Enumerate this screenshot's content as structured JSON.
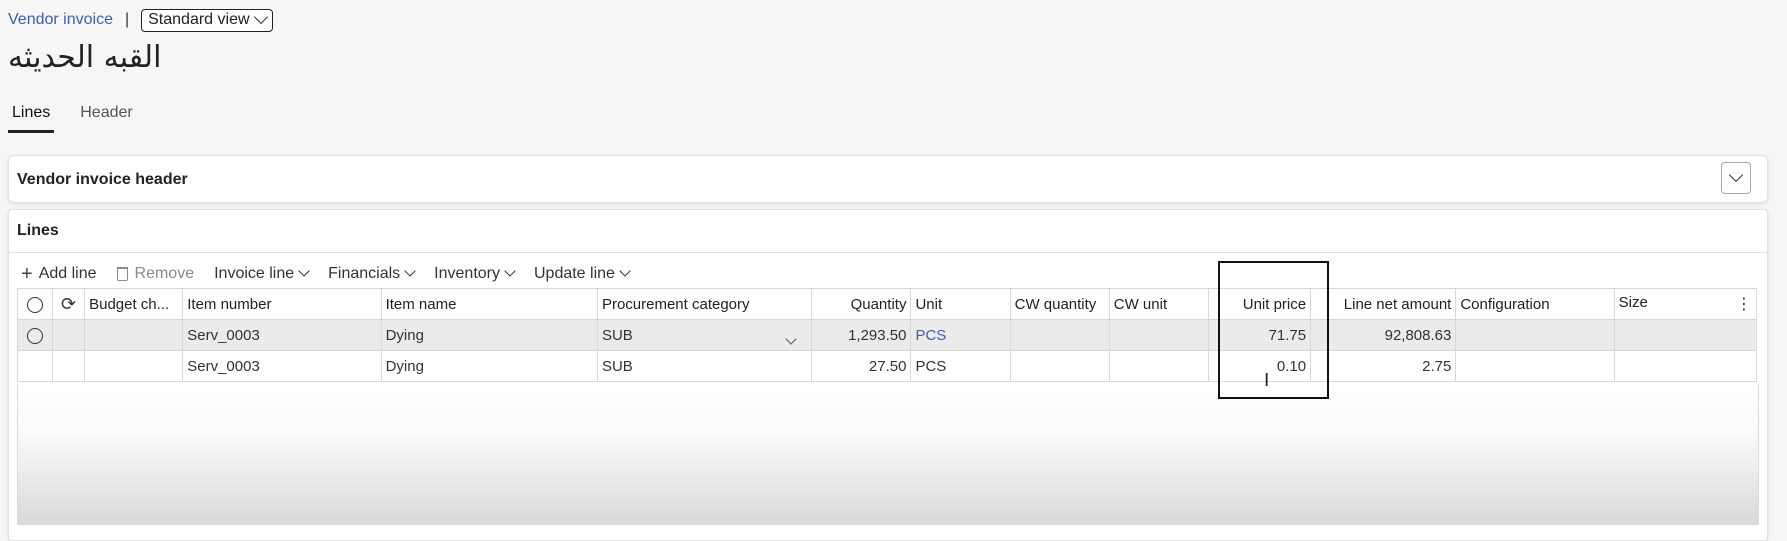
{
  "breadcrumb": {
    "link": "Vendor invoice",
    "separator": "|",
    "view": "Standard view"
  },
  "page_title": "القبه الحديثه",
  "tabs": [
    {
      "label": "Lines",
      "active": true
    },
    {
      "label": "Header",
      "active": false
    }
  ],
  "header_section": {
    "title": "Vendor invoice header"
  },
  "lines_section": {
    "title": "Lines"
  },
  "toolbar": {
    "add_line": "Add line",
    "remove": "Remove",
    "invoice_line": "Invoice line",
    "financials": "Financials",
    "inventory": "Inventory",
    "update_line": "Update line"
  },
  "columns": {
    "budget": "Budget ch...",
    "item_number": "Item number",
    "item_name": "Item name",
    "procurement_category": "Procurement category",
    "quantity": "Quantity",
    "unit": "Unit",
    "cw_quantity": "CW quantity",
    "cw_unit": "CW unit",
    "unit_price": "Unit price",
    "line_net_amount": "Line net amount",
    "configuration": "Configuration",
    "size": "Size"
  },
  "rows": [
    {
      "item_number": "Serv_0003",
      "item_name": "Dying",
      "procurement_category": "SUB",
      "quantity": "1,293.50",
      "unit": "PCS",
      "unit_price": "71.75",
      "line_net_amount": "92,808.63",
      "selected": true
    },
    {
      "item_number": "Serv_0003",
      "item_name": "Dying",
      "procurement_category": "SUB",
      "quantity": "27.50",
      "unit": "PCS",
      "unit_price": "0.10",
      "line_net_amount": "2.75",
      "selected": false
    }
  ],
  "colors": {
    "link": "#3a5fb0",
    "selected_row": "#ebebeb"
  }
}
